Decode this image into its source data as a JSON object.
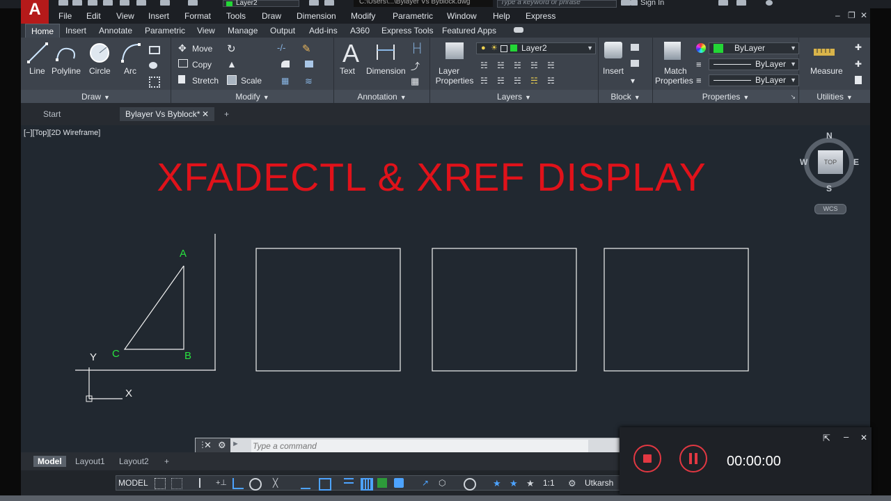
{
  "window": {
    "logo_letter": "A",
    "quick_layer": "Layer2",
    "file_path": "C:\\Users\\...\\Bylayer Vs Byblock.dwg",
    "search_placeholder": "Type a keyword or phrase",
    "sign_in": "Sign In"
  },
  "menu": [
    "File",
    "Edit",
    "View",
    "Insert",
    "Format",
    "Tools",
    "Draw",
    "Dimension",
    "Modify",
    "Parametric",
    "Window",
    "Help",
    "Express"
  ],
  "ribbon_tabs": [
    "Home",
    "Insert",
    "Annotate",
    "Parametric",
    "View",
    "Manage",
    "Output",
    "Add-ins",
    "A360",
    "Express Tools",
    "Featured Apps"
  ],
  "ribbon": {
    "draw": {
      "title": "Draw",
      "line": "Line",
      "polyline": "Polyline",
      "circle": "Circle",
      "arc": "Arc"
    },
    "modify": {
      "title": "Modify",
      "move": "Move",
      "copy": "Copy",
      "stretch": "Stretch",
      "scale": "Scale"
    },
    "annotation": {
      "title": "Annotation",
      "text": "Text",
      "dimension": "Dimension"
    },
    "layers": {
      "title": "Layers",
      "layer_properties_1": "Layer",
      "layer_properties_2": "Properties",
      "current_layer": "Layer2"
    },
    "block": {
      "title": "Block",
      "insert": "Insert"
    },
    "properties": {
      "title": "Properties",
      "match_1": "Match",
      "match_2": "Properties",
      "color": "ByLayer",
      "linetype": "ByLayer",
      "lineweight": "ByLayer"
    },
    "utilities": {
      "title": "Utilities",
      "measure": "Measure"
    }
  },
  "doc_tabs": [
    "Start",
    "Bylayer Vs Byblock*"
  ],
  "viewport_label": "[−][Top][2D Wireframe]",
  "drawing": {
    "title": "XFADECTL & XREF DISPLAY",
    "point_a": "A",
    "point_b": "B",
    "point_c": "C",
    "ucs_x": "X",
    "ucs_y": "Y",
    "title_color": "#e0121a",
    "label_color": "#29e23f"
  },
  "viewcube": {
    "n": "N",
    "s": "S",
    "e": "E",
    "w": "W",
    "top": "TOP",
    "wcs": "WCS"
  },
  "command_placeholder": "Type a command",
  "layout_tabs": [
    "Model",
    "Layout1",
    "Layout2"
  ],
  "status": {
    "model": "MODEL",
    "scale": "1:1",
    "workspace": "Utkarsh"
  },
  "recorder": {
    "time": "00:00:00"
  }
}
